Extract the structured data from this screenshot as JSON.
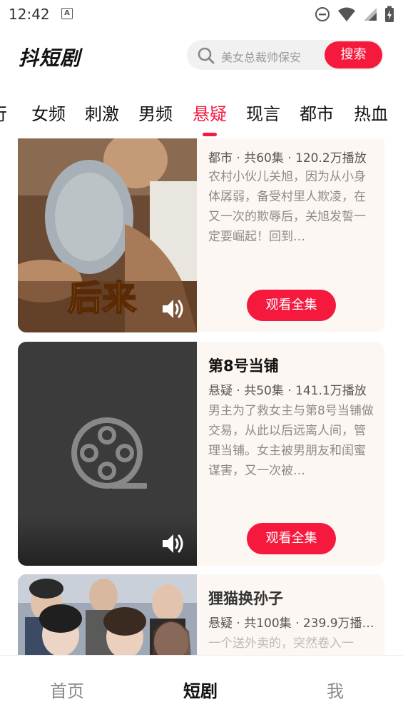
{
  "status_bar": {
    "time": "12:42",
    "notification_icon": "A"
  },
  "header": {
    "logo": "抖短剧",
    "search_placeholder": "美女总裁帅保安",
    "search_button": "搜索"
  },
  "tabs": [
    {
      "label": "行"
    },
    {
      "label": "女频"
    },
    {
      "label": "刺激"
    },
    {
      "label": "男频"
    },
    {
      "label": "悬疑",
      "active": true
    },
    {
      "label": "现言"
    },
    {
      "label": "都市"
    },
    {
      "label": "热血"
    }
  ],
  "cards": [
    {
      "meta": "都市 · 共60集 · 120.2万播放",
      "desc": "农村小伙儿关旭，因为从小身体孱弱，备受村里人欺凌，在又一次的欺辱后，关旭发誓一定要崛起！回到…",
      "watch": "观看全集",
      "poster_text": "后来"
    },
    {
      "title": "第8号当铺",
      "meta": "悬疑 · 共50集 · 141.1万播放",
      "desc": "男主为了救女主与第8号当铺做交易，从此以后远离人间，管理当铺。女主被男朋友和闺蜜谋害，又一次被…",
      "watch": "观看全集"
    },
    {
      "title": "狸猫换孙子",
      "meta": "悬疑 · 共100集 · 239.9万播…",
      "desc": "一个送外卖的，突然卷入一"
    }
  ],
  "bottom_nav": [
    {
      "label": "首页"
    },
    {
      "label": "短剧",
      "active": true
    },
    {
      "label": "我"
    }
  ],
  "colors": {
    "accent": "#f5193e",
    "card_bg": "#fdf7f3"
  }
}
